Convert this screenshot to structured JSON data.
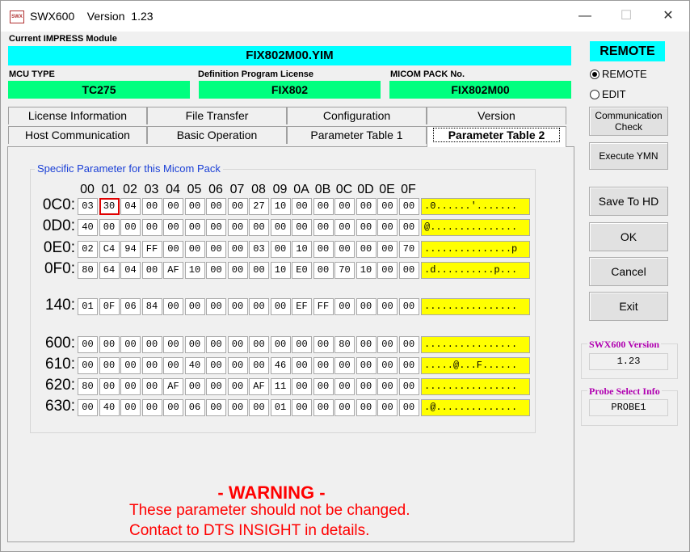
{
  "window": {
    "icon_text": "SWX",
    "title": "SWX600    Version  1.23",
    "minimize": "—",
    "maximize": "☐",
    "close": "✕"
  },
  "module": {
    "label": "Current IMPRESS Module",
    "value": "FIX802M00.YIM"
  },
  "mcu": {
    "label": "MCU TYPE",
    "value": "TC275"
  },
  "definition": {
    "label": "Definition Program License",
    "value": "FIX802"
  },
  "micom": {
    "label": "MICOM PACK No.",
    "value": "FIX802M00"
  },
  "tabs_row1": [
    "License Information",
    "File Transfer",
    "Configuration",
    "Version"
  ],
  "tabs_row2": [
    "Host Communication",
    "Basic Operation",
    "Parameter Table 1",
    "Parameter Table 2"
  ],
  "active_tab": "Parameter Table 2",
  "group_title": "Specific Parameter for this Micom Pack",
  "col_headers": [
    "00",
    "01",
    "02",
    "03",
    "04",
    "05",
    "06",
    "07",
    "08",
    "09",
    "0A",
    "0B",
    "0C",
    "0D",
    "0E",
    "0F"
  ],
  "rows": [
    {
      "addr": "0C0:",
      "cells": [
        "03",
        "30",
        "04",
        "00",
        "00",
        "00",
        "00",
        "00",
        "27",
        "10",
        "00",
        "00",
        "00",
        "00",
        "00",
        "00"
      ],
      "ascii": ".0......'......."
    },
    {
      "addr": "0D0:",
      "cells": [
        "40",
        "00",
        "00",
        "00",
        "00",
        "00",
        "00",
        "00",
        "00",
        "00",
        "00",
        "00",
        "00",
        "00",
        "00",
        "00"
      ],
      "ascii": "@..............."
    },
    {
      "addr": "0E0:",
      "cells": [
        "02",
        "C4",
        "94",
        "FF",
        "00",
        "00",
        "00",
        "00",
        "03",
        "00",
        "10",
        "00",
        "00",
        "00",
        "00",
        "70"
      ],
      "ascii": "...............p"
    },
    {
      "addr": "0F0:",
      "cells": [
        "80",
        "64",
        "04",
        "00",
        "AF",
        "10",
        "00",
        "00",
        "00",
        "10",
        "E0",
        "00",
        "70",
        "10",
        "00",
        "00"
      ],
      "ascii": ".d..........p..."
    },
    {
      "addr": "140:",
      "cells": [
        "01",
        "0F",
        "06",
        "84",
        "00",
        "00",
        "00",
        "00",
        "00",
        "00",
        "EF",
        "FF",
        "00",
        "00",
        "00",
        "00"
      ],
      "ascii": "................"
    },
    {
      "addr": "600:",
      "cells": [
        "00",
        "00",
        "00",
        "00",
        "00",
        "00",
        "00",
        "00",
        "00",
        "00",
        "00",
        "00",
        "80",
        "00",
        "00",
        "00"
      ],
      "ascii": "................"
    },
    {
      "addr": "610:",
      "cells": [
        "00",
        "00",
        "00",
        "00",
        "00",
        "40",
        "00",
        "00",
        "00",
        "46",
        "00",
        "00",
        "00",
        "00",
        "00",
        "00"
      ],
      "ascii": ".....@...F......"
    },
    {
      "addr": "620:",
      "cells": [
        "80",
        "00",
        "00",
        "00",
        "AF",
        "00",
        "00",
        "00",
        "AF",
        "11",
        "00",
        "00",
        "00",
        "00",
        "00",
        "00"
      ],
      "ascii": "................"
    },
    {
      "addr": "630:",
      "cells": [
        "00",
        "40",
        "00",
        "00",
        "00",
        "06",
        "00",
        "00",
        "00",
        "01",
        "00",
        "00",
        "00",
        "00",
        "00",
        "00"
      ],
      "ascii": ".@.............."
    }
  ],
  "selected_cell": {
    "row": "0C0:",
    "col": "01"
  },
  "warning": {
    "title": "- WARNING -",
    "line1": "These parameter should not be changed.",
    "line2": "Contact to DTS INSIGHT in details."
  },
  "side": {
    "remote_badge": "REMOTE",
    "radio_remote": "REMOTE",
    "radio_edit": "EDIT",
    "radio_selected": "REMOTE",
    "comm_check_line1": "Communication",
    "comm_check_line2": "Check",
    "execute_ymn": "Execute YMN",
    "save_to_hd": "Save To HD",
    "ok": "OK",
    "cancel": "Cancel",
    "exit": "Exit",
    "version_title": "SWX600 Version",
    "version_value": "1.23",
    "probe_title": "Probe Select Info",
    "probe_value": "PROBE1"
  },
  "colors": {
    "cyan": "#00ffff",
    "green": "#00ff7f",
    "yellow": "#ffff00",
    "warning": "#ff0000",
    "group_title": "#1a3fd6",
    "info_title": "#b000b0",
    "selection": "#e00000"
  }
}
